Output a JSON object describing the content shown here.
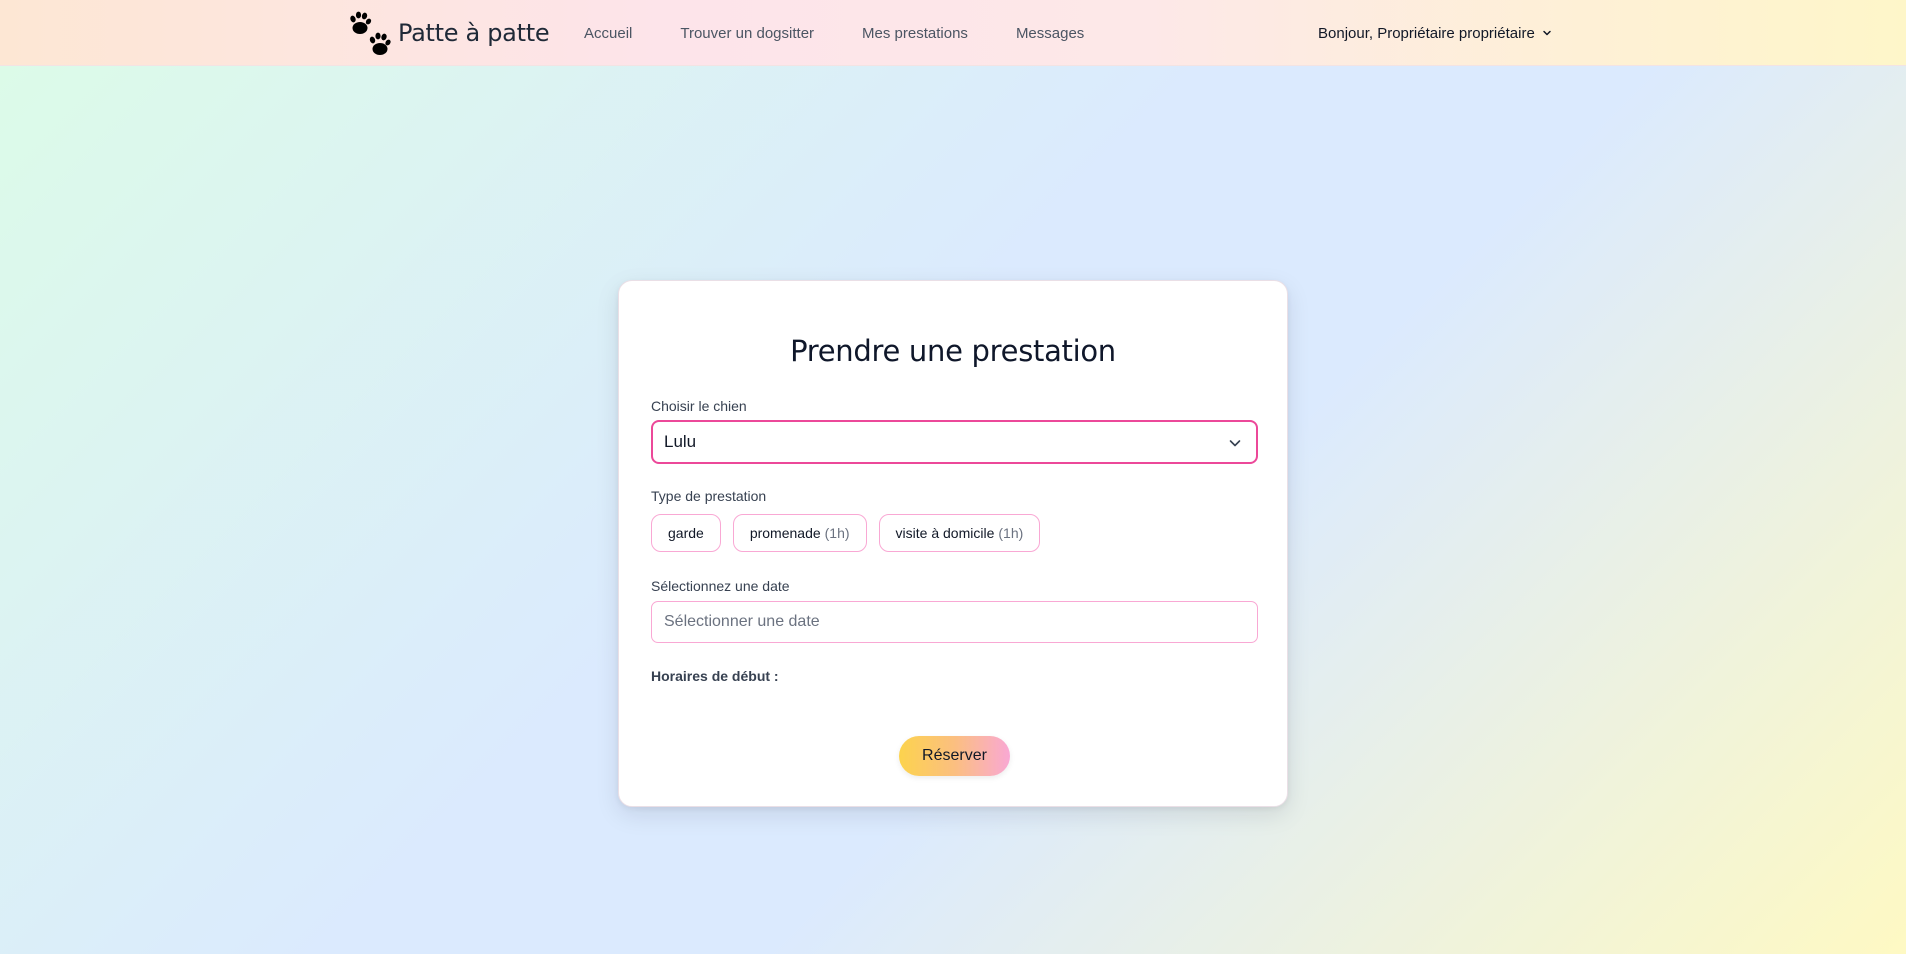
{
  "navbar": {
    "brand": {
      "name": "Patte à patte",
      "icon": "paw-prints-icon"
    },
    "links": [
      {
        "label": "Accueil"
      },
      {
        "label": "Trouver un dogsitter"
      },
      {
        "label": "Mes prestations"
      },
      {
        "label": "Messages"
      }
    ],
    "user_menu": {
      "greeting": "Bonjour, Propriétaire propriétaire",
      "icon": "chevron-down-icon"
    }
  },
  "form": {
    "title": "Prendre une prestation",
    "dog": {
      "label": "Choisir le chien",
      "selected": "Lulu",
      "icon": "chevron-down-icon"
    },
    "service_type": {
      "label": "Type de prestation",
      "options": [
        {
          "name": "garde",
          "duration": ""
        },
        {
          "name": "promenade",
          "duration": "(1h)"
        },
        {
          "name": "visite à domicile",
          "duration": "(1h)"
        }
      ]
    },
    "date": {
      "label": "Sélectionnez une date",
      "placeholder": "Sélectionner une date",
      "value": ""
    },
    "start_times": {
      "label": "Horaires de début :"
    },
    "submit_label": "Réserver"
  },
  "colors": {
    "accent_pink": "#ec4899",
    "pill_border": "#f9a8d4",
    "button_gradient_start": "#fcd34d",
    "button_gradient_end": "#f9a8d4"
  }
}
